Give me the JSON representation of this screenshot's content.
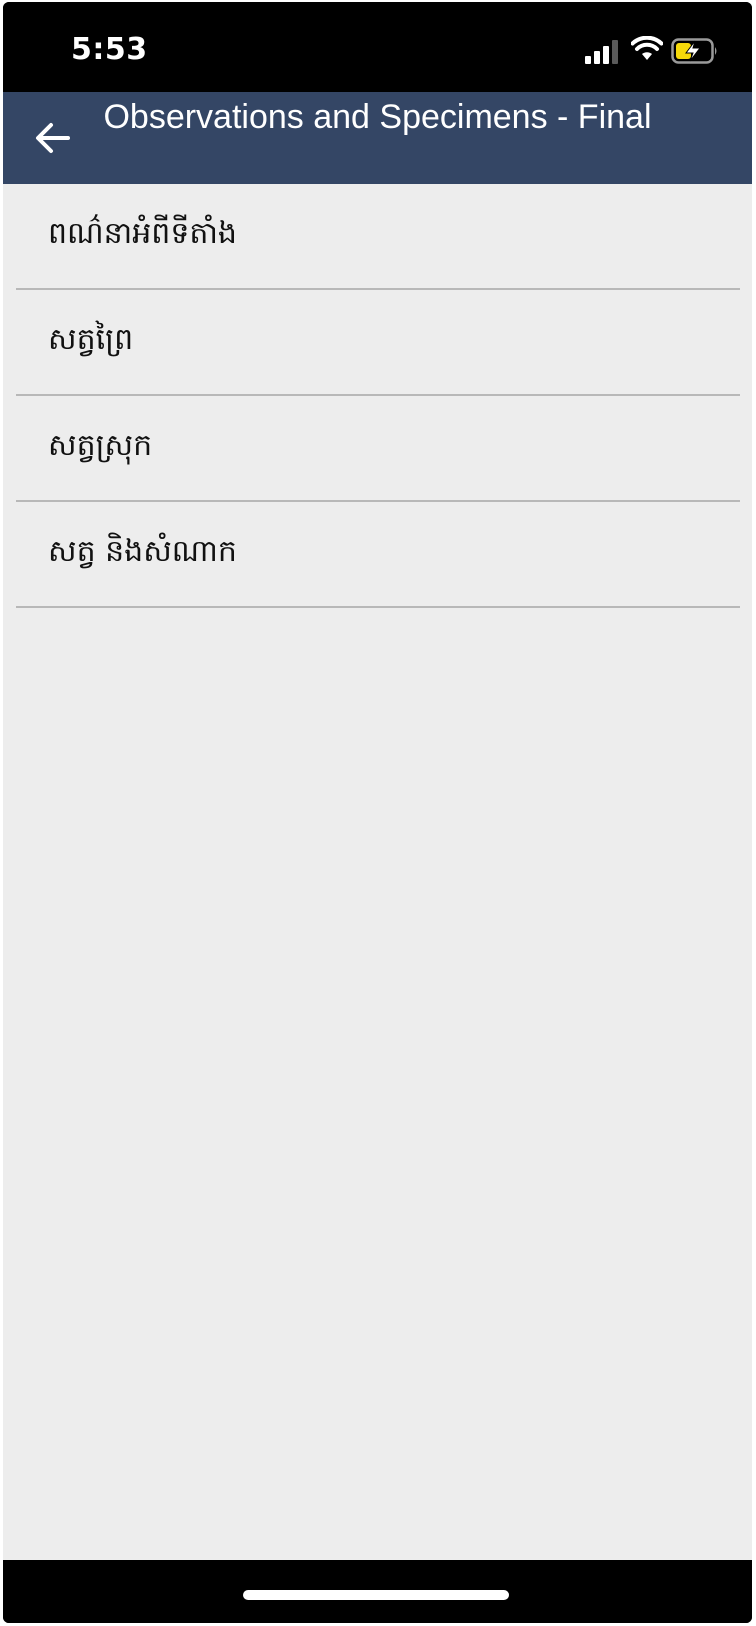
{
  "status_bar": {
    "time": "5:53"
  },
  "header": {
    "title": "Observations and Specimens - Final"
  },
  "list": {
    "items": [
      {
        "label": "ពណ៌នាអំពីទីតាំង"
      },
      {
        "label": "សត្វព្រៃ"
      },
      {
        "label": "សត្វស្រុក"
      },
      {
        "label": "សត្វ និងសំណាក"
      }
    ]
  },
  "colors": {
    "header_bg": "#344665",
    "content_bg": "#ededed",
    "divider": "#b8b8b8",
    "battery_fill": "#f5d90a"
  }
}
